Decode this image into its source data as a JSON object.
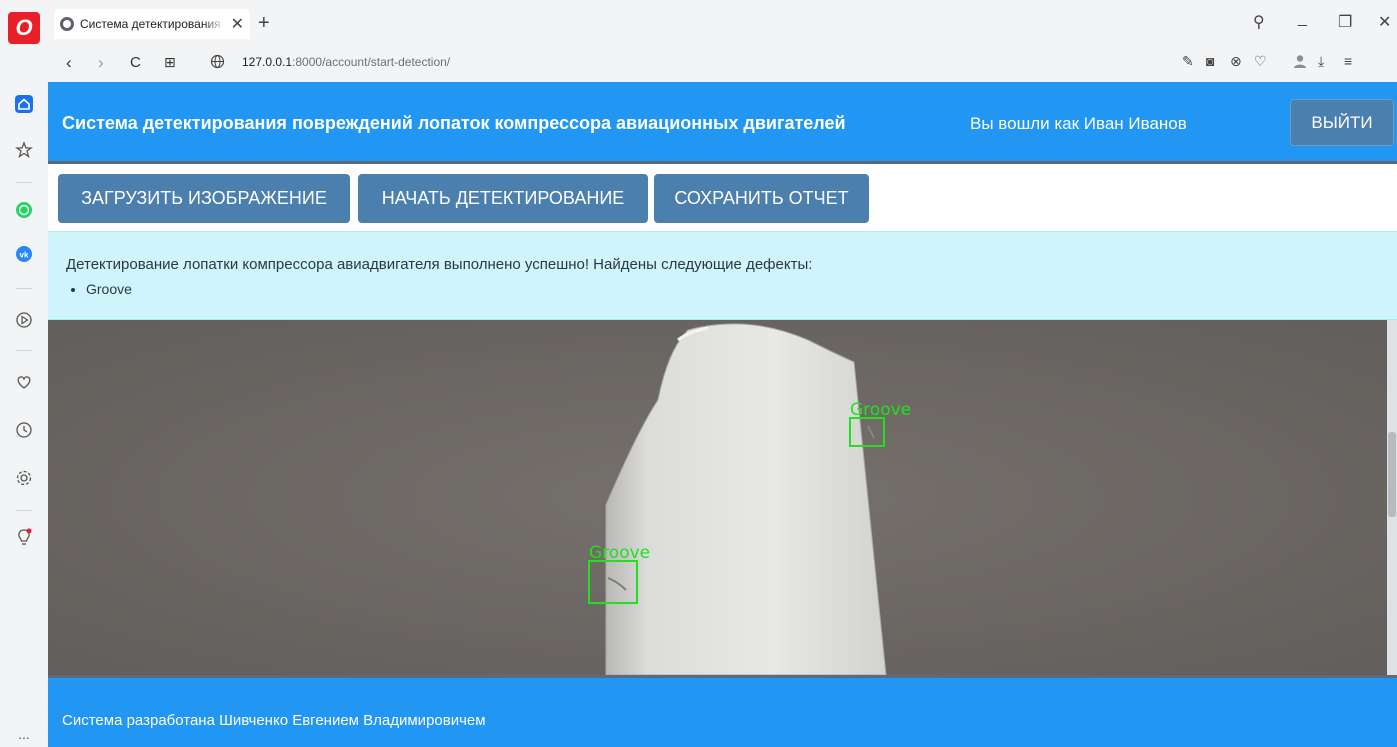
{
  "browser": {
    "logo": "O",
    "tab_title": "Система детектирования п",
    "new_tab": "+",
    "url_host": "127.0.0.1",
    "url_path": ":8000/account/start-detection/",
    "nav_back": "‹",
    "nav_forward": "›",
    "nav_reload": "C",
    "nav_grid": "⊞",
    "window_search": "⚲",
    "window_minimize": "_",
    "window_restore": "❐",
    "window_close": "✕",
    "rail_more": "..."
  },
  "header": {
    "title": "Система детектирования повреждений лопаток компрессора авиационных двигателей",
    "user_text": "Вы вошли как Иван Иванов",
    "logout_label": "ВЫЙТИ"
  },
  "toolbar": {
    "upload_label": "ЗАГРУЗИТЬ ИЗОБРАЖЕНИЕ",
    "detect_label": "НАЧАТЬ ДЕТЕКТИРОВАНИЕ",
    "save_label": "СОХРАНИТЬ ОТЧЕТ"
  },
  "alert": {
    "message": "Детектирование лопатки компрессора авиадвигателя выполнено успешно! Найдены следующие дефекты:",
    "defects": [
      "Groove"
    ]
  },
  "detection_image": {
    "labels": [
      "Groove",
      "Groove"
    ],
    "box_color": "#22e01e"
  },
  "footer": {
    "text": "Система разработана Шивченко Евгением Владимировичем"
  },
  "colors": {
    "header_bg": "#2196f3",
    "button_bg": "#4a7fae",
    "alert_bg": "#cff4fc"
  }
}
